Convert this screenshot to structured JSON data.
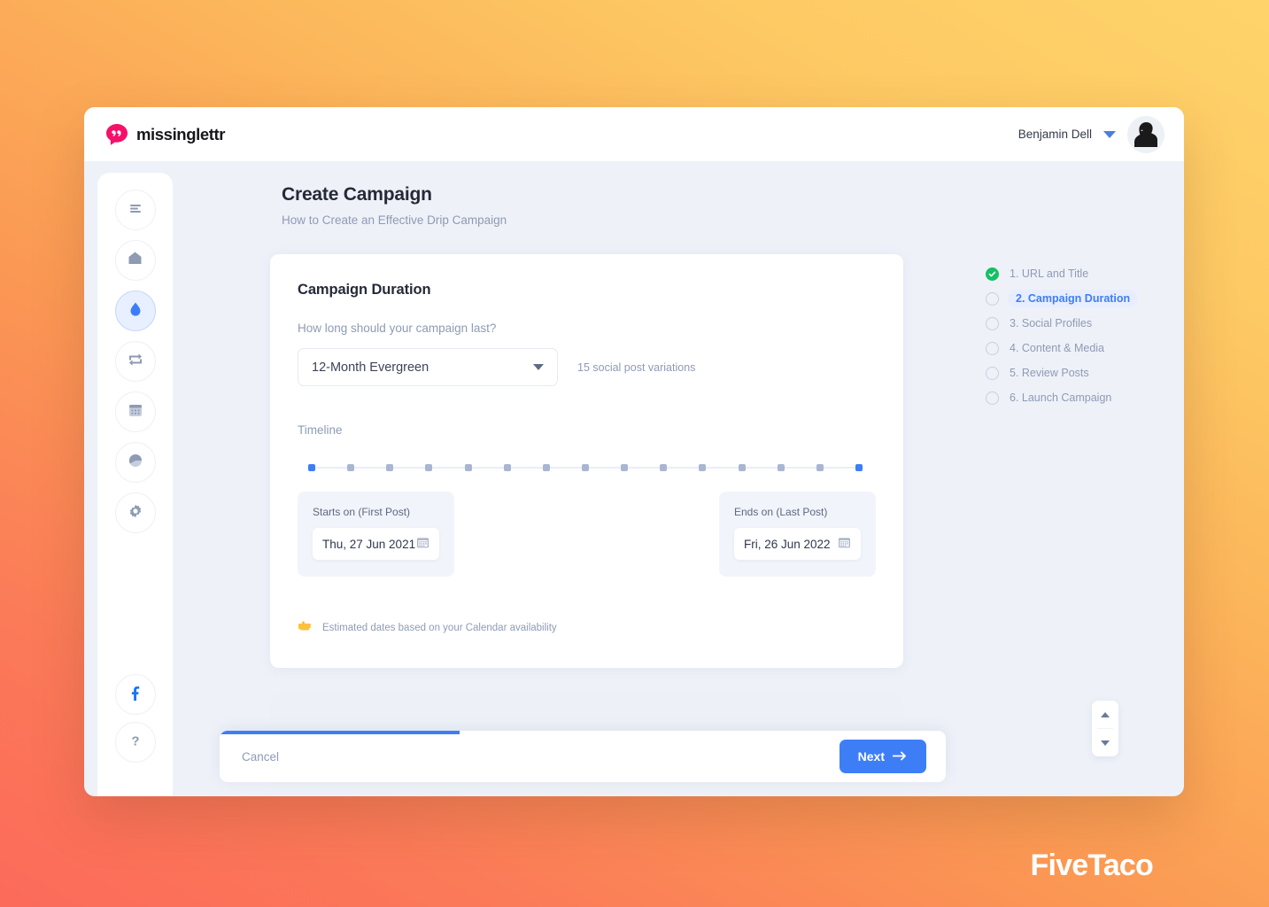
{
  "brand": {
    "name": "missinglettr",
    "logo_icon": "quote-bubble-icon",
    "color": "#f5106a"
  },
  "topbar": {
    "user_name": "Benjamin Dell",
    "caret_icon": "chevron-down-icon",
    "avatar_icon": "user-avatar"
  },
  "sidebar": {
    "items": [
      {
        "icon": "menu-icon",
        "name": "menu"
      },
      {
        "icon": "home-icon",
        "name": "home"
      },
      {
        "icon": "droplet-icon",
        "name": "drip-campaigns",
        "active": true
      },
      {
        "icon": "repeat-icon",
        "name": "curate"
      },
      {
        "icon": "calendar-icon",
        "name": "calendar"
      },
      {
        "icon": "pie-chart-icon",
        "name": "analytics"
      },
      {
        "icon": "gear-icon",
        "name": "settings"
      }
    ],
    "bottom_items": [
      {
        "icon": "facebook-icon",
        "name": "facebook",
        "color": "#1877f2"
      },
      {
        "icon": "question-mark-icon",
        "name": "help"
      }
    ]
  },
  "page": {
    "title": "Create Campaign",
    "subtitle": "How to Create an Effective Drip Campaign"
  },
  "card": {
    "title": "Campaign Duration",
    "duration_label": "How long should your campaign last?",
    "duration_value": "12-Month Evergreen",
    "duration_caret_icon": "chevron-down-icon",
    "variations_text": "15 social post variations",
    "timeline_label": "Timeline",
    "start": {
      "label": "Starts on (First Post)",
      "value": "Thu, 27 Jun 2021",
      "icon": "calendar-icon"
    },
    "end": {
      "label": "Ends on (Last Post)",
      "value": "Fri, 26 Jun 2022",
      "icon": "calendar-icon"
    },
    "hint_icon": "pointing-finger-icon",
    "hint_text": "Estimated dates based on your Calendar availability"
  },
  "timeline": {
    "marker_count": 15,
    "endpoint_color": "#3d7ef7",
    "midpoint_color": "#a9b6d2"
  },
  "steps": [
    {
      "label": "1. URL and Title",
      "state": "done"
    },
    {
      "label": "2. Campaign Duration",
      "state": "current"
    },
    {
      "label": "3. Social Profiles",
      "state": "pending"
    },
    {
      "label": "4. Content & Media",
      "state": "pending"
    },
    {
      "label": "5. Review Posts",
      "state": "pending"
    },
    {
      "label": "6. Launch Campaign",
      "state": "pending"
    }
  ],
  "scroll_nub": {
    "up_icon": "caret-up-icon",
    "down_icon": "caret-down-icon"
  },
  "footer": {
    "cancel_label": "Cancel",
    "next_label": "Next",
    "next_icon": "arrow-right-icon",
    "progress_percent": 33
  },
  "watermark": {
    "text": "FiveTaco"
  }
}
